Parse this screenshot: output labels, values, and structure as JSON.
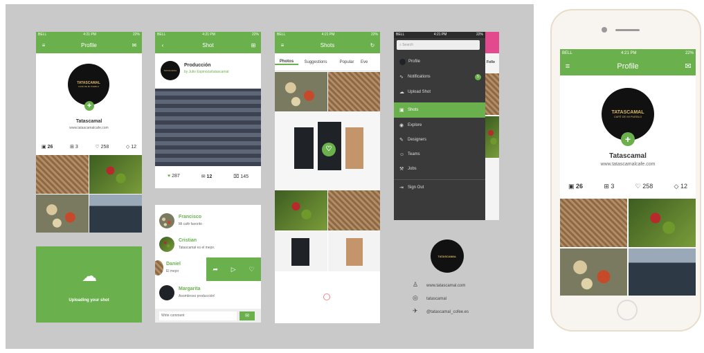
{
  "status": {
    "carrier": "BELL",
    "time": "4:21 PM",
    "battery": "22%"
  },
  "profile": {
    "title": "Profile",
    "name": "Tatascamal",
    "website": "www.tatascamalcafe.com",
    "stats": {
      "shots": "26",
      "buckets": "3",
      "likes": "258",
      "tags": "12"
    },
    "logo_text": "TATASCAMAL",
    "logo_sub": "CAFÉ DE MI PUEBLO"
  },
  "uploading": {
    "label": "Uploading your shot"
  },
  "shot": {
    "title": "Shot",
    "post_title": "Producción",
    "post_by": "by Julio Espinoza/tatascamal",
    "likes": "287",
    "comments": "12",
    "trash": "145",
    "comment_placeholder": "Write comment",
    "comment_list": [
      {
        "name": "Francisco",
        "text": "Mi café favorito"
      },
      {
        "name": "Cristian",
        "text": "Tatascamal es el mejor."
      },
      {
        "name": "Daniel",
        "text": "El mejor"
      },
      {
        "name": "Margarita",
        "text": "Asombroso producción!"
      }
    ]
  },
  "shots": {
    "title": "Shots",
    "tabs": [
      "Photos",
      "Suggestions",
      "Popular",
      "Eve"
    ]
  },
  "menu": {
    "search_placeholder": "Search",
    "items": [
      "Profile",
      "Notifications",
      "Upload Shot",
      "Shots",
      "Explore",
      "Designers",
      "Teams",
      "Jobs",
      "Sign Out"
    ],
    "notif_count": "5",
    "peek_label": "Follo"
  },
  "contact": {
    "site": "www.tatascamal.com",
    "dribbble": "tatascamal",
    "twitter": "@tatascamal_cofee.es"
  },
  "colors": {
    "accent": "#6ab04c",
    "menu_bg": "#3a3a3a",
    "canvas": "#c9c9c9"
  }
}
